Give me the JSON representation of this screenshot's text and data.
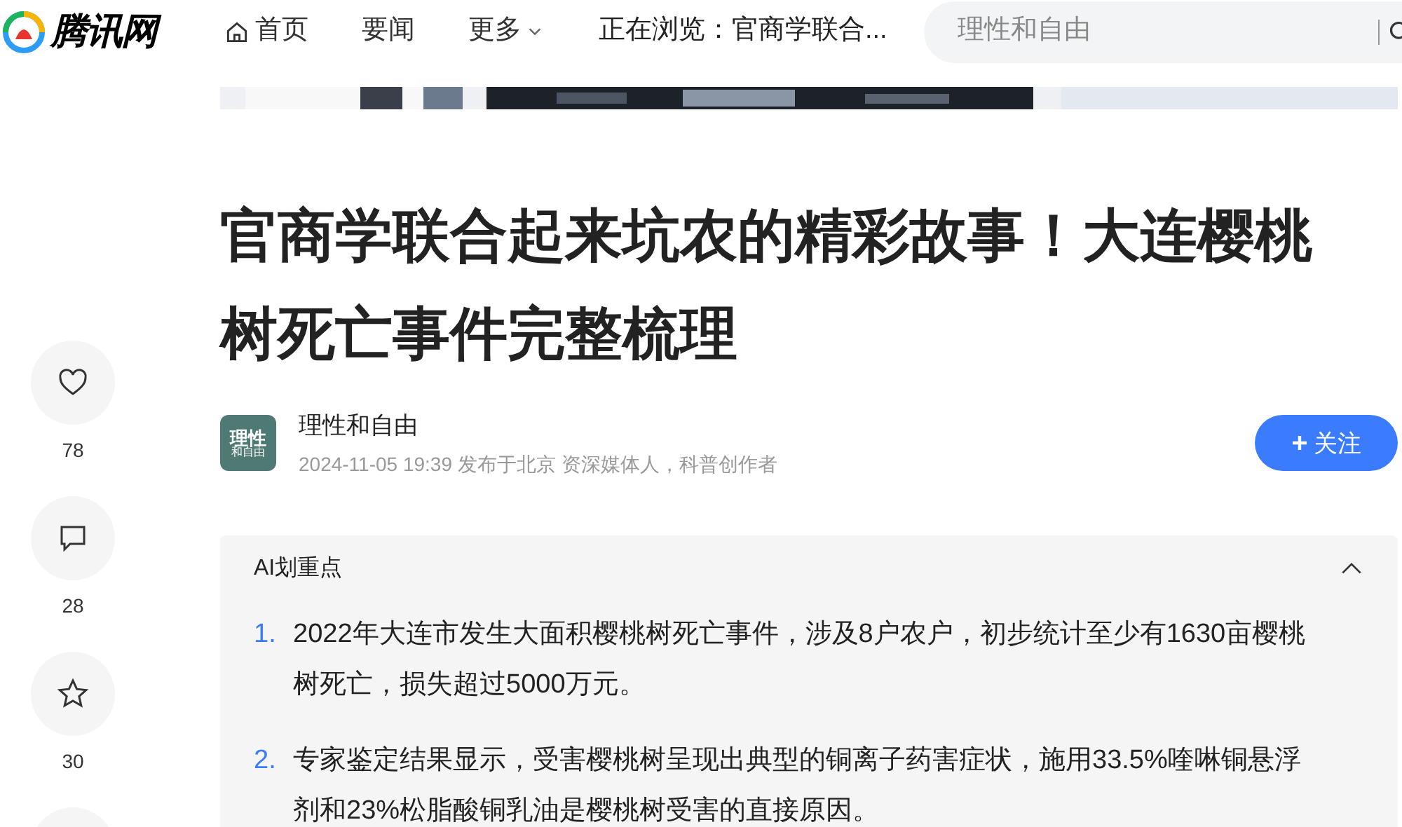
{
  "header": {
    "logo": "腾讯网",
    "nav": [
      {
        "kind": "home",
        "label": "首页"
      },
      {
        "kind": "plain",
        "label": "要闻"
      },
      {
        "kind": "dropdown",
        "label": "更多"
      }
    ],
    "browsing": "正在浏览：官商学联合...",
    "search": {
      "placeholder": "理性和自由"
    }
  },
  "rail": [
    {
      "kind": "like",
      "count": "78"
    },
    {
      "kind": "comment",
      "count": "28"
    },
    {
      "kind": "favorite",
      "count": "30"
    },
    {
      "kind": "partial"
    }
  ],
  "article": {
    "title": "官商学联合起来坑农的精彩故事！大连樱桃树死亡事件完整梳理",
    "author": {
      "avatar_text": [
        "理性",
        "和自由"
      ],
      "name": "理性和自由",
      "meta": "2024-11-05 19:39 发布于北京 资深媒体人，科普创作者",
      "follow": "关注"
    },
    "summary": {
      "title": "AI划重点",
      "expanded": true,
      "points": [
        {
          "number": "1.",
          "text": "2022年大连市发生大面积樱桃树死亡事件，涉及8户农户，初步统计至少有1630亩樱桃树死亡，损失超过5000万元。"
        },
        {
          "number": "2.",
          "text": "专家鉴定结果显示，受害樱桃树呈现出典型的铜离子药害症状，施用33.5%喹啉铜悬浮剂和23%松脂酸铜乳油是樱桃树受害的直接原因。"
        }
      ]
    }
  }
}
